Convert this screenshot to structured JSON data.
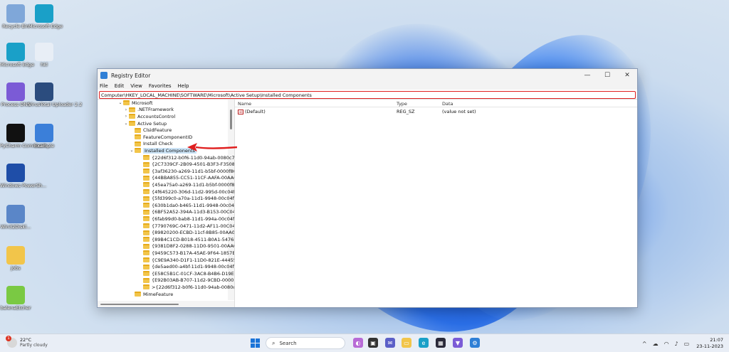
{
  "desktop": {
    "icons": [
      {
        "label": "Recycle Bin",
        "icon": "recycle-bin-icon",
        "color": "#7fa7d9"
      },
      {
        "label": "Microsoft Edge",
        "icon": "edge-icon",
        "color": "#1aa0c8"
      },
      {
        "label": "Microsoft Edge",
        "icon": "edge-icon",
        "color": "#1aa0c8"
      },
      {
        "label": "hkl",
        "icon": "file-icon",
        "color": "#e8eef6"
      },
      {
        "label": "Process DNS",
        "icon": "process-icon",
        "color": "#7b5bd6"
      },
      {
        "label": "VirusTotal Uploader 2.2",
        "icon": "virustotal-icon",
        "color": "#2b4c7e"
      },
      {
        "label": "PyCharm Communit...",
        "icon": "pycharm-icon",
        "color": "#111111"
      },
      {
        "label": "Example",
        "icon": "example-icon",
        "color": "#3b7fd9"
      },
      {
        "label": "Windows PowerSh...",
        "icon": "powershell-icon",
        "color": "#1f4ea8"
      },
      {
        "label": "Win32Diskl...",
        "icon": "disk-icon",
        "color": "#5a86c8"
      },
      {
        "label": "jobs",
        "icon": "folder-icon",
        "color": "#f2c54a"
      },
      {
        "label": "balenaEtcher",
        "icon": "etcher-icon",
        "color": "#7ac943"
      }
    ]
  },
  "window": {
    "title": "Registry Editor",
    "controls": {
      "minimize": "—",
      "maximize": "☐",
      "close": "✕"
    },
    "menu": [
      "File",
      "Edit",
      "View",
      "Favorites",
      "Help"
    ],
    "address": "Computer\\HKEY_LOCAL_MACHINE\\SOFTWARE\\Microsoft\\Active Setup\\Installed Components",
    "tree": [
      {
        "label": "Microsoft",
        "arrow": "v",
        "level": 0
      },
      {
        "label": ".NETFramework",
        "arrow": ">",
        "level": 1
      },
      {
        "label": "AccountsControl",
        "arrow": ">",
        "level": 1
      },
      {
        "label": "Active Setup",
        "arrow": "v",
        "level": 1
      },
      {
        "label": "ClsidFeature",
        "arrow": "",
        "level": 2
      },
      {
        "label": "FeatureComponentID",
        "arrow": "",
        "level": 2
      },
      {
        "label": "Install Check",
        "arrow": "",
        "level": 2
      },
      {
        "label": "Installed Components",
        "arrow": "v",
        "level": 2,
        "selected": true
      },
      {
        "label": "{22d6f312-b0f6-11d0-94ab-0080c74c7e",
        "arrow": "",
        "level": 3
      },
      {
        "label": "{2C7339CF-2B09-4501-B3F3-F3508C92",
        "arrow": "",
        "level": 3
      },
      {
        "label": "{3af36230-a269-11d1-b5bf-0000f80515",
        "arrow": "",
        "level": 3
      },
      {
        "label": "{44BBA855-CC51-11CF-AAFA-00AA00B",
        "arrow": "",
        "level": 3
      },
      {
        "label": "{45ea75a0-a269-11d1-b5bf-0000f80515",
        "arrow": "",
        "level": 3
      },
      {
        "label": "{4f645220-306d-11d2-995d-00c04f98bb",
        "arrow": "",
        "level": 3
      },
      {
        "label": "{5fd399c0-a70a-11d1-9948-00c04f98bb",
        "arrow": "",
        "level": 3
      },
      {
        "label": "{630b1da0-b465-11d1-9948-00c04f98b",
        "arrow": "",
        "level": 3
      },
      {
        "label": "{6BF52A52-394A-11d3-B153-00C04F79",
        "arrow": "",
        "level": 3
      },
      {
        "label": "{6fab99d0-bab8-11d1-994a-00c04f98bb",
        "arrow": "",
        "level": 3
      },
      {
        "label": "{7790769C-0471-11d2-AF11-00C04FA3",
        "arrow": "",
        "level": 3
      },
      {
        "label": "{89820200-ECBD-11cf-8B85-00AA005B",
        "arrow": "",
        "level": 3
      },
      {
        "label": "{89B4C1CD-B018-4511-B0A1-5476DBF",
        "arrow": "",
        "level": 3
      },
      {
        "label": "{9381D8F2-0288-11D0-9501-00AA00B9",
        "arrow": "",
        "level": 3
      },
      {
        "label": "{9459C573-B17A-45AE-9F64-1857B5D5",
        "arrow": "",
        "level": 3
      },
      {
        "label": "{C9E9A340-D1F1-11D0-821E-44455354",
        "arrow": "",
        "level": 3
      },
      {
        "label": "{de5aed00-a4bf-11d1-9948-00c04f98b",
        "arrow": "",
        "level": 3
      },
      {
        "label": "{E58C5B1C-01CF-3AC8-B4B6-D19E2AC",
        "arrow": "",
        "level": 3
      },
      {
        "label": "{E92B03AB-B707-11d2-9CBD-0000F87A",
        "arrow": "",
        "level": 3
      },
      {
        "label": ">{22d6f312-b0f6-11d0-94ab-0080c74c7",
        "arrow": "",
        "level": 3
      },
      {
        "label": "MimeFeature",
        "arrow": "",
        "level": 2
      }
    ],
    "columns": {
      "name": "Name",
      "type": "Type",
      "data": "Data"
    },
    "values": [
      {
        "name": "(Default)",
        "type": "REG_SZ",
        "data": "(value not set)"
      }
    ]
  },
  "annotation_color": "#e01f1f",
  "taskbar": {
    "weather_temp": "22°C",
    "weather_desc": "Partly cloudy",
    "notification_count": "1",
    "search_label": "Search",
    "time": "21:07",
    "date": "23-11-2023"
  }
}
